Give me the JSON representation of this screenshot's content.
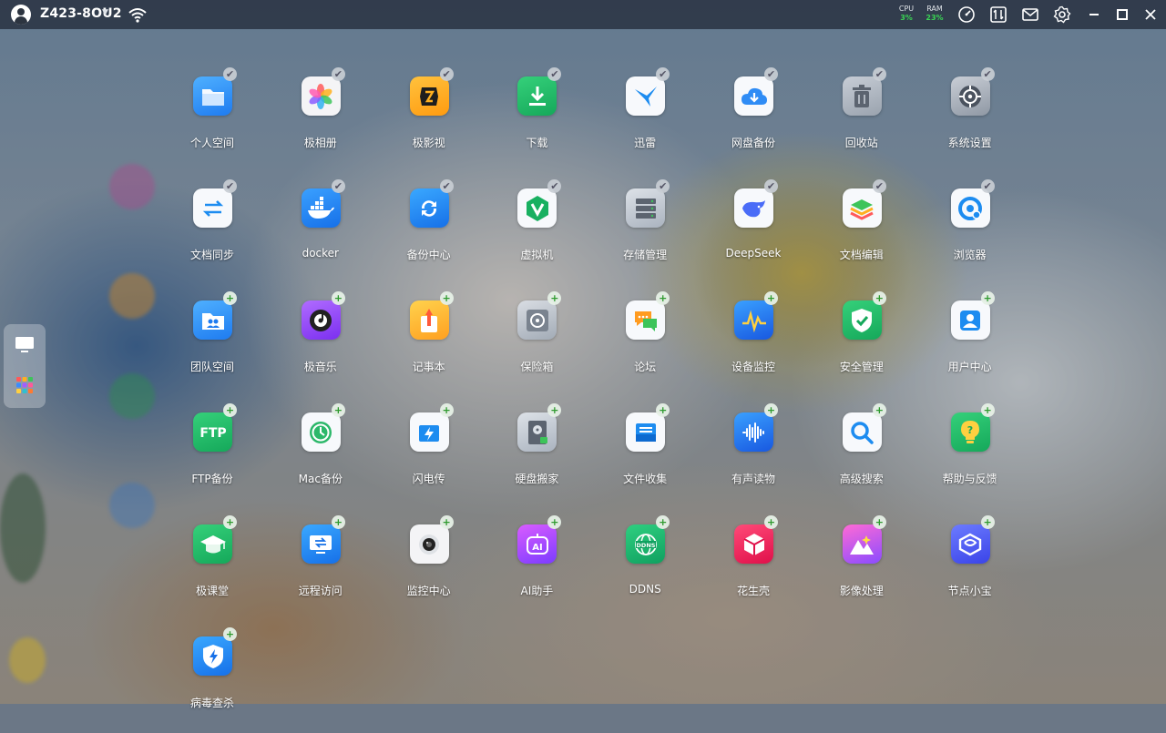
{
  "topbar": {
    "device_name": "Z423-8OU2",
    "cpu_label": "CPU",
    "cpu_value": "3%",
    "ram_label": "RAM",
    "ram_value": "23%",
    "icons": [
      "wifi-icon",
      "speedometer-icon",
      "transfer-icon",
      "mail-icon",
      "settings-icon",
      "minimize-icon",
      "maximize-icon",
      "close-icon"
    ]
  },
  "dock": {
    "items": [
      {
        "name": "desktop-view-icon"
      },
      {
        "name": "app-grid-icon"
      }
    ]
  },
  "apps": [
    {
      "label": "个人空间",
      "icon": "folder-icon",
      "status": "installed"
    },
    {
      "label": "极相册",
      "icon": "photos-icon",
      "status": "installed"
    },
    {
      "label": "极影视",
      "icon": "video-icon",
      "status": "installed"
    },
    {
      "label": "下载",
      "icon": "download-icon",
      "status": "installed"
    },
    {
      "label": "迅雷",
      "icon": "thunder-icon",
      "status": "installed"
    },
    {
      "label": "网盘备份",
      "icon": "cloud-backup-icon",
      "status": "installed"
    },
    {
      "label": "回收站",
      "icon": "trash-icon",
      "status": "installed"
    },
    {
      "label": "系统设置",
      "icon": "settings-icon",
      "status": "installed"
    },
    {
      "label": "文档同步",
      "icon": "sync-icon",
      "status": "installed"
    },
    {
      "label": "docker",
      "icon": "docker-icon",
      "status": "installed"
    },
    {
      "label": "备份中心",
      "icon": "backup-icon",
      "status": "installed"
    },
    {
      "label": "虚拟机",
      "icon": "vm-icon",
      "status": "installed"
    },
    {
      "label": "存储管理",
      "icon": "storage-icon",
      "status": "installed"
    },
    {
      "label": "DeepSeek",
      "icon": "deepseek-icon",
      "status": "installed"
    },
    {
      "label": "文档编辑",
      "icon": "document-edit-icon",
      "status": "installed"
    },
    {
      "label": "浏览器",
      "icon": "browser-icon",
      "status": "installed"
    },
    {
      "label": "团队空间",
      "icon": "team-folder-icon",
      "status": "add"
    },
    {
      "label": "极音乐",
      "icon": "music-icon",
      "status": "add"
    },
    {
      "label": "记事本",
      "icon": "notepad-icon",
      "status": "add"
    },
    {
      "label": "保险箱",
      "icon": "safe-icon",
      "status": "add"
    },
    {
      "label": "论坛",
      "icon": "forum-icon",
      "status": "add"
    },
    {
      "label": "设备监控",
      "icon": "monitor-icon",
      "status": "add"
    },
    {
      "label": "安全管理",
      "icon": "shield-icon",
      "status": "add"
    },
    {
      "label": "用户中心",
      "icon": "user-icon",
      "status": "add"
    },
    {
      "label": "FTP备份",
      "icon": "ftp-icon",
      "status": "add"
    },
    {
      "label": "Mac备份",
      "icon": "time-machine-icon",
      "status": "add"
    },
    {
      "label": "闪电传",
      "icon": "flash-transfer-icon",
      "status": "add"
    },
    {
      "label": "硬盘搬家",
      "icon": "disk-move-icon",
      "status": "add"
    },
    {
      "label": "文件收集",
      "icon": "file-collect-icon",
      "status": "add"
    },
    {
      "label": "有声读物",
      "icon": "audiobook-icon",
      "status": "add"
    },
    {
      "label": "高级搜索",
      "icon": "search-icon",
      "status": "add"
    },
    {
      "label": "帮助与反馈",
      "icon": "help-icon",
      "status": "add"
    },
    {
      "label": "极课堂",
      "icon": "graduation-icon",
      "status": "add"
    },
    {
      "label": "远程访问",
      "icon": "remote-access-icon",
      "status": "add"
    },
    {
      "label": "监控中心",
      "icon": "camera-icon",
      "status": "add"
    },
    {
      "label": "AI助手",
      "icon": "ai-assistant-icon",
      "status": "add"
    },
    {
      "label": "DDNS",
      "icon": "ddns-icon",
      "status": "add"
    },
    {
      "label": "花生壳",
      "icon": "peanut-shell-icon",
      "status": "add"
    },
    {
      "label": "影像处理",
      "icon": "image-processing-icon",
      "status": "add"
    },
    {
      "label": "节点小宝",
      "icon": "node-icon",
      "status": "add"
    },
    {
      "label": "病毒查杀",
      "icon": "antivirus-icon",
      "status": "add"
    }
  ],
  "badge_glyphs": {
    "installed": "✔",
    "add": "+"
  },
  "colors": {
    "topbar": "#242c3a",
    "stat_value": "#39d353",
    "add_badge": "#2e9a2e"
  }
}
